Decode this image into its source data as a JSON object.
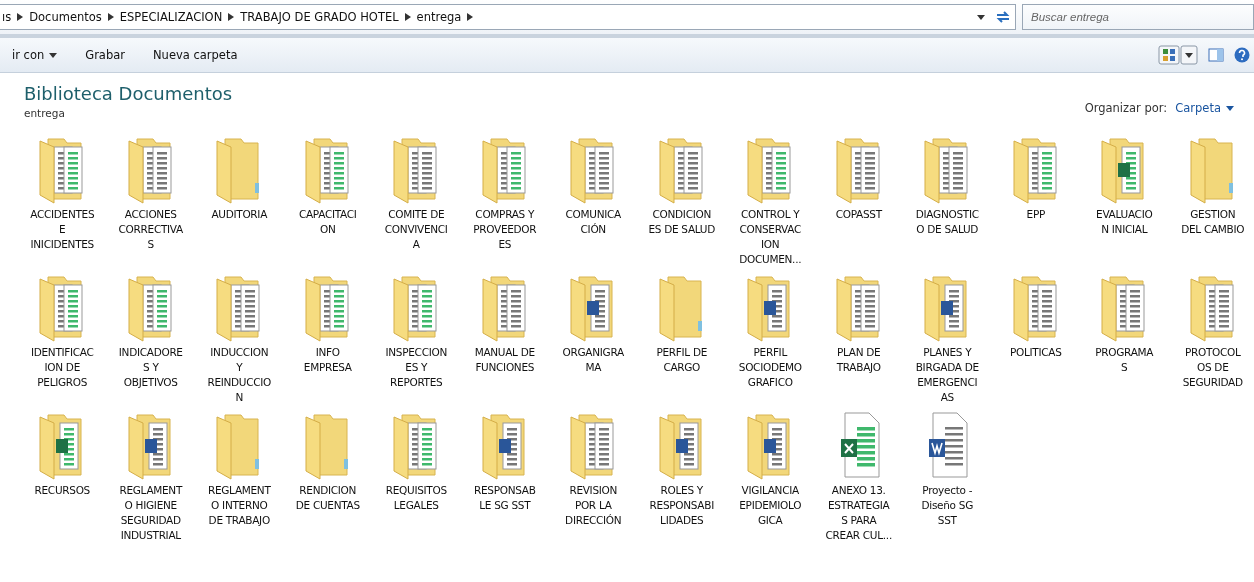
{
  "address_bar": {
    "crumbs": [
      "ıs",
      "Documentos",
      "ESPECIALIZACION",
      "TRABAJO DE GRADO HOTEL",
      "entrega"
    ],
    "search": {
      "placeholder": "Buscar entrega"
    }
  },
  "toolbar": {
    "buttons": [
      {
        "label": "ir con",
        "has_menu": true
      },
      {
        "label": "Grabar",
        "has_menu": false
      },
      {
        "label": "Nueva carpeta",
        "has_menu": false
      }
    ]
  },
  "library": {
    "title": "Biblioteca Documentos",
    "subtitle": "entrega",
    "arrange_label": "Organizar por:",
    "arrange_value": "Carpeta"
  },
  "items": [
    {
      "kind": "folder-sheets",
      "label": [
        "ACCIDENTES",
        "E",
        "INICIDENTES"
      ]
    },
    {
      "kind": "folder-docs",
      "label": [
        "ACCIONES",
        "CORRECTIVA",
        "S"
      ]
    },
    {
      "kind": "folder-empty",
      "label": [
        "AUDITORIA"
      ]
    },
    {
      "kind": "folder-sheets",
      "label": [
        "CAPACITACI",
        "ON"
      ]
    },
    {
      "kind": "folder-docs",
      "label": [
        "COMITE DE",
        "CONVIVENCI",
        "A"
      ]
    },
    {
      "kind": "folder-sheets",
      "label": [
        "COMPRAS Y",
        "PROVEEDOR",
        "ES"
      ]
    },
    {
      "kind": "folder-docs",
      "label": [
        "COMUNICA",
        "CIÓN"
      ]
    },
    {
      "kind": "folder-docs",
      "label": [
        "CONDICION",
        "ES DE SALUD"
      ]
    },
    {
      "kind": "folder-sheets",
      "label": [
        "CONTROL Y",
        "CONSERVAC",
        "ION",
        "DOCUMEN..."
      ]
    },
    {
      "kind": "folder-docs",
      "label": [
        "COPASST"
      ]
    },
    {
      "kind": "folder-docs",
      "label": [
        "DIAGNOSTIC",
        "O DE SALUD"
      ]
    },
    {
      "kind": "folder-sheets",
      "label": [
        "EPP"
      ]
    },
    {
      "kind": "folder-excel",
      "label": [
        "EVALUACIO",
        "N INICIAL"
      ]
    },
    {
      "kind": "folder-empty",
      "label": [
        "GESTION",
        "DEL CAMBIO"
      ]
    },
    {
      "kind": "folder-sheets",
      "label": [
        "IDENTIFICAC",
        "ION DE",
        "PELIGROS"
      ]
    },
    {
      "kind": "folder-sheets",
      "label": [
        "INDICADORE",
        "S Y",
        "OBJETIVOS"
      ]
    },
    {
      "kind": "folder-docs",
      "label": [
        "INDUCCION",
        "Y",
        "REINDUCCIO",
        "N"
      ]
    },
    {
      "kind": "folder-sheets",
      "label": [
        "INFO",
        "EMPRESA"
      ]
    },
    {
      "kind": "folder-sheets",
      "label": [
        "INSPECCION",
        "ES Y",
        "REPORTES"
      ]
    },
    {
      "kind": "folder-docs",
      "label": [
        "MANUAL DE",
        "FUNCIONES"
      ]
    },
    {
      "kind": "folder-word",
      "label": [
        "ORGANIGRA",
        "MA"
      ]
    },
    {
      "kind": "folder-empty",
      "label": [
        "PERFIL DE",
        "CARGO"
      ]
    },
    {
      "kind": "folder-word",
      "label": [
        "PERFIL",
        "SOCIODEMO",
        "GRAFICO"
      ]
    },
    {
      "kind": "folder-docs",
      "label": [
        "PLAN DE",
        "TRABAJO"
      ]
    },
    {
      "kind": "folder-word",
      "label": [
        "PLANES Y",
        "BIRGADA DE",
        "EMERGENCI",
        "AS"
      ]
    },
    {
      "kind": "folder-docs",
      "label": [
        "POLITICAS"
      ]
    },
    {
      "kind": "folder-docs",
      "label": [
        "PROGRAMA",
        "S"
      ]
    },
    {
      "kind": "folder-docs",
      "label": [
        "PROTOCOL",
        "OS DE",
        "SEGURIDAD"
      ]
    },
    {
      "kind": "folder-excel",
      "label": [
        "RECURSOS"
      ]
    },
    {
      "kind": "folder-word",
      "label": [
        "REGLAMENT",
        "O HIGIENE",
        "SEGURIDAD",
        "INDUSTRIAL"
      ]
    },
    {
      "kind": "folder-empty",
      "label": [
        "REGLAMENT",
        "O INTERNO",
        "DE TRABAJO"
      ]
    },
    {
      "kind": "folder-empty",
      "label": [
        "RENDICION",
        "DE CUENTAS"
      ]
    },
    {
      "kind": "folder-sheets",
      "label": [
        "REQUISITOS",
        "LEGALES"
      ]
    },
    {
      "kind": "folder-word",
      "label": [
        "RESPONSAB",
        "LE SG SST"
      ]
    },
    {
      "kind": "folder-docs",
      "label": [
        "REVISION",
        "POR LA",
        "DIRECCIÓN"
      ]
    },
    {
      "kind": "folder-word",
      "label": [
        "ROLES Y",
        "RESPONSABI",
        "LIDADES"
      ]
    },
    {
      "kind": "folder-word",
      "label": [
        "VIGILANCIA",
        "EPIDEMIOLO",
        "GICA"
      ]
    },
    {
      "kind": "excel",
      "label": [
        "ANEXO 13.",
        "ESTRATEGIA",
        "S PARA",
        "CREAR CUL..."
      ]
    },
    {
      "kind": "word",
      "label": [
        "Proyecto -",
        "Diseño SG",
        "SST"
      ]
    }
  ]
}
